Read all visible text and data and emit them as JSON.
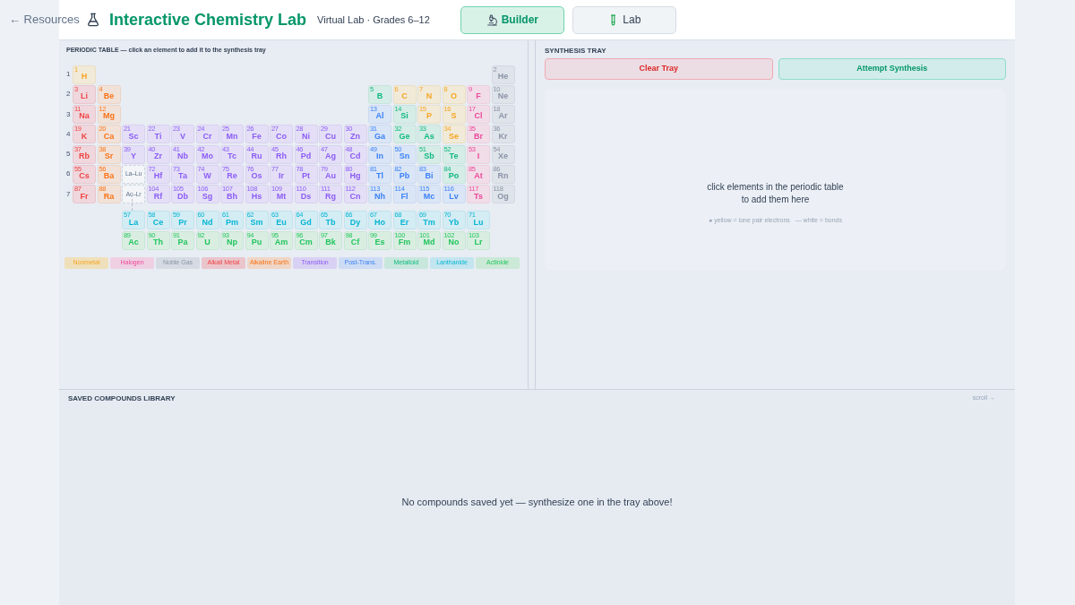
{
  "header": {
    "back_link": "← Resources",
    "title": "Interactive Chemistry Lab",
    "subtitle": "Virtual Lab · Grades 6–12",
    "tabs": [
      {
        "label": "Builder",
        "kind": "microscope",
        "selected": true
      },
      {
        "label": "Lab",
        "kind": "tube",
        "selected": false
      }
    ]
  },
  "periodic_table": {
    "heading": "PERIODIC TABLE — click an element to add it to the synthesis tray",
    "rows": [
      {
        "label": "1",
        "left": [
          {
            "number": "1",
            "symbol": "H",
            "kind": "nonmetal"
          }
        ],
        "right": [
          {
            "number": "2",
            "symbol": "He",
            "kind": "noble"
          }
        ]
      },
      {
        "label": "2",
        "left": [
          {
            "number": "3",
            "symbol": "Li",
            "kind": "alkali"
          },
          {
            "number": "4",
            "symbol": "Be",
            "kind": "alkaline"
          }
        ],
        "right": [
          {
            "number": "5",
            "symbol": "B",
            "kind": "metalloid"
          },
          {
            "number": "6",
            "symbol": "C",
            "kind": "nonmetal"
          },
          {
            "number": "7",
            "symbol": "N",
            "kind": "nonmetal"
          },
          {
            "number": "8",
            "symbol": "O",
            "kind": "nonmetal"
          },
          {
            "number": "9",
            "symbol": "F",
            "kind": "halogen"
          },
          {
            "number": "10",
            "symbol": "Ne",
            "kind": "noble"
          }
        ]
      },
      {
        "label": "3",
        "left": [
          {
            "number": "11",
            "symbol": "Na",
            "kind": "alkali"
          },
          {
            "number": "12",
            "symbol": "Mg",
            "kind": "alkaline"
          }
        ],
        "right": [
          {
            "number": "13",
            "symbol": "Al",
            "kind": "post"
          },
          {
            "number": "14",
            "symbol": "Si",
            "kind": "metalloid"
          },
          {
            "number": "15",
            "symbol": "P",
            "kind": "nonmetal"
          },
          {
            "number": "16",
            "symbol": "S",
            "kind": "nonmetal"
          },
          {
            "number": "17",
            "symbol": "Cl",
            "kind": "halogen"
          },
          {
            "number": "18",
            "symbol": "Ar",
            "kind": "noble"
          }
        ]
      },
      {
        "label": "4",
        "left": [
          {
            "number": "19",
            "symbol": "K",
            "kind": "alkali"
          },
          {
            "number": "20",
            "symbol": "Ca",
            "kind": "alkaline"
          },
          {
            "number": "21",
            "symbol": "Sc",
            "kind": "transition"
          },
          {
            "number": "22",
            "symbol": "Ti",
            "kind": "transition"
          },
          {
            "number": "23",
            "symbol": "V",
            "kind": "transition"
          },
          {
            "number": "24",
            "symbol": "Cr",
            "kind": "transition"
          },
          {
            "number": "25",
            "symbol": "Mn",
            "kind": "transition"
          },
          {
            "number": "26",
            "symbol": "Fe",
            "kind": "transition"
          },
          {
            "number": "27",
            "symbol": "Co",
            "kind": "transition"
          },
          {
            "number": "28",
            "symbol": "Ni",
            "kind": "transition"
          },
          {
            "number": "29",
            "symbol": "Cu",
            "kind": "transition"
          },
          {
            "number": "30",
            "symbol": "Zn",
            "kind": "transition"
          },
          {
            "number": "31",
            "symbol": "Ga",
            "kind": "post"
          },
          {
            "number": "32",
            "symbol": "Ge",
            "kind": "metalloid"
          },
          {
            "number": "33",
            "symbol": "As",
            "kind": "metalloid"
          },
          {
            "number": "34",
            "symbol": "Se",
            "kind": "nonmetal"
          },
          {
            "number": "35",
            "symbol": "Br",
            "kind": "halogen"
          },
          {
            "number": "36",
            "symbol": "Kr",
            "kind": "noble"
          }
        ]
      },
      {
        "label": "5",
        "left": [
          {
            "number": "37",
            "symbol": "Rb",
            "kind": "alkali"
          },
          {
            "number": "38",
            "symbol": "Sr",
            "kind": "alkaline"
          },
          {
            "number": "39",
            "symbol": "Y",
            "kind": "transition"
          },
          {
            "number": "40",
            "symbol": "Zr",
            "kind": "transition"
          },
          {
            "number": "41",
            "symbol": "Nb",
            "kind": "transition"
          },
          {
            "number": "42",
            "symbol": "Mo",
            "kind": "transition"
          },
          {
            "number": "43",
            "symbol": "Tc",
            "kind": "transition"
          },
          {
            "number": "44",
            "symbol": "Ru",
            "kind": "transition"
          },
          {
            "number": "45",
            "symbol": "Rh",
            "kind": "transition"
          },
          {
            "number": "46",
            "symbol": "Pd",
            "kind": "transition"
          },
          {
            "number": "47",
            "symbol": "Ag",
            "kind": "transition"
          },
          {
            "number": "48",
            "symbol": "Cd",
            "kind": "transition"
          },
          {
            "number": "49",
            "symbol": "In",
            "kind": "post"
          },
          {
            "number": "50",
            "symbol": "Sn",
            "kind": "post"
          },
          {
            "number": "51",
            "symbol": "Sb",
            "kind": "metalloid"
          },
          {
            "number": "52",
            "symbol": "Te",
            "kind": "metalloid"
          },
          {
            "number": "53",
            "symbol": "I",
            "kind": "halogen"
          },
          {
            "number": "54",
            "symbol": "Xe",
            "kind": "noble"
          }
        ]
      },
      {
        "label": "6",
        "left": [
          {
            "number": "55",
            "symbol": "Cs",
            "kind": "alkali"
          },
          {
            "number": "56",
            "symbol": "Ba",
            "kind": "alkaline"
          },
          {
            "kind": "placeholder",
            "symbol": "La–Lu"
          },
          {
            "number": "72",
            "symbol": "Hf",
            "kind": "transition"
          },
          {
            "number": "73",
            "symbol": "Ta",
            "kind": "transition"
          },
          {
            "number": "74",
            "symbol": "W",
            "kind": "transition"
          },
          {
            "number": "75",
            "symbol": "Re",
            "kind": "transition"
          },
          {
            "number": "76",
            "symbol": "Os",
            "kind": "transition"
          },
          {
            "number": "77",
            "symbol": "Ir",
            "kind": "transition"
          },
          {
            "number": "78",
            "symbol": "Pt",
            "kind": "transition"
          },
          {
            "number": "79",
            "symbol": "Au",
            "kind": "transition"
          },
          {
            "number": "80",
            "symbol": "Hg",
            "kind": "transition"
          },
          {
            "number": "81",
            "symbol": "Tl",
            "kind": "post"
          },
          {
            "number": "82",
            "symbol": "Pb",
            "kind": "post"
          },
          {
            "number": "83",
            "symbol": "Bi",
            "kind": "post"
          },
          {
            "number": "84",
            "symbol": "Po",
            "kind": "metalloid"
          },
          {
            "number": "85",
            "symbol": "At",
            "kind": "halogen"
          },
          {
            "number": "86",
            "symbol": "Rn",
            "kind": "noble"
          }
        ]
      },
      {
        "label": "7",
        "left": [
          {
            "number": "87",
            "symbol": "Fr",
            "kind": "alkali"
          },
          {
            "number": "88",
            "symbol": "Ra",
            "kind": "alkaline"
          },
          {
            "kind": "placeholder",
            "symbol": "Ac–Lr"
          },
          {
            "number": "104",
            "symbol": "Rf",
            "kind": "transition"
          },
          {
            "number": "105",
            "symbol": "Db",
            "kind": "transition"
          },
          {
            "number": "106",
            "symbol": "Sg",
            "kind": "transition"
          },
          {
            "number": "107",
            "symbol": "Bh",
            "kind": "transition"
          },
          {
            "number": "108",
            "symbol": "Hs",
            "kind": "transition"
          },
          {
            "number": "109",
            "symbol": "Mt",
            "kind": "transition"
          },
          {
            "number": "110",
            "symbol": "Ds",
            "kind": "transition"
          },
          {
            "number": "111",
            "symbol": "Rg",
            "kind": "transition"
          },
          {
            "number": "112",
            "symbol": "Cn",
            "kind": "transition"
          },
          {
            "number": "113",
            "symbol": "Nh",
            "kind": "post"
          },
          {
            "number": "114",
            "symbol": "Fl",
            "kind": "post"
          },
          {
            "number": "115",
            "symbol": "Mc",
            "kind": "post"
          },
          {
            "number": "116",
            "symbol": "Lv",
            "kind": "post"
          },
          {
            "number": "117",
            "symbol": "Ts",
            "kind": "halogen"
          },
          {
            "number": "118",
            "symbol": "Og",
            "kind": "noble"
          }
        ]
      }
    ],
    "f_block": [
      [
        {
          "number": "57",
          "symbol": "La",
          "kind": "lanthanide"
        },
        {
          "number": "58",
          "symbol": "Ce",
          "kind": "lanthanide"
        },
        {
          "number": "59",
          "symbol": "Pr",
          "kind": "lanthanide"
        },
        {
          "number": "60",
          "symbol": "Nd",
          "kind": "lanthanide"
        },
        {
          "number": "61",
          "symbol": "Pm",
          "kind": "lanthanide"
        },
        {
          "number": "62",
          "symbol": "Sm",
          "kind": "lanthanide"
        },
        {
          "number": "63",
          "symbol": "Eu",
          "kind": "lanthanide"
        },
        {
          "number": "64",
          "symbol": "Gd",
          "kind": "lanthanide"
        },
        {
          "number": "65",
          "symbol": "Tb",
          "kind": "lanthanide"
        },
        {
          "number": "66",
          "symbol": "Dy",
          "kind": "lanthanide"
        },
        {
          "number": "67",
          "symbol": "Ho",
          "kind": "lanthanide"
        },
        {
          "number": "68",
          "symbol": "Er",
          "kind": "lanthanide"
        },
        {
          "number": "69",
          "symbol": "Tm",
          "kind": "lanthanide"
        },
        {
          "number": "70",
          "symbol": "Yb",
          "kind": "lanthanide"
        },
        {
          "number": "71",
          "symbol": "Lu",
          "kind": "lanthanide"
        }
      ],
      [
        {
          "number": "89",
          "symbol": "Ac",
          "kind": "actinide"
        },
        {
          "number": "90",
          "symbol": "Th",
          "kind": "actinide"
        },
        {
          "number": "91",
          "symbol": "Pa",
          "kind": "actinide"
        },
        {
          "number": "92",
          "symbol": "U",
          "kind": "actinide"
        },
        {
          "number": "93",
          "symbol": "Np",
          "kind": "actinide"
        },
        {
          "number": "94",
          "symbol": "Pu",
          "kind": "actinide"
        },
        {
          "number": "95",
          "symbol": "Am",
          "kind": "actinide"
        },
        {
          "number": "96",
          "symbol": "Cm",
          "kind": "actinide"
        },
        {
          "number": "97",
          "symbol": "Bk",
          "kind": "actinide"
        },
        {
          "number": "98",
          "symbol": "Cf",
          "kind": "actinide"
        },
        {
          "number": "99",
          "symbol": "Es",
          "kind": "actinide"
        },
        {
          "number": "100",
          "symbol": "Fm",
          "kind": "actinide"
        },
        {
          "number": "101",
          "symbol": "Md",
          "kind": "actinide"
        },
        {
          "number": "102",
          "symbol": "No",
          "kind": "actinide"
        },
        {
          "number": "103",
          "symbol": "Lr",
          "kind": "actinide"
        }
      ]
    ],
    "legend": [
      {
        "label": "Nonmetal",
        "kind": "nonmetal"
      },
      {
        "label": "Halogen",
        "kind": "halogen"
      },
      {
        "label": "Noble Gas",
        "kind": "noble"
      },
      {
        "label": "Alkali Metal",
        "kind": "alkali"
      },
      {
        "label": "Alkaline Earth",
        "kind": "alkaline"
      },
      {
        "label": "Transition",
        "kind": "transition"
      },
      {
        "label": "Post-Trans.",
        "kind": "post"
      },
      {
        "label": "Metalloid",
        "kind": "metalloid"
      },
      {
        "label": "Lanthanide",
        "kind": "lanthanide"
      },
      {
        "label": "Actinide",
        "kind": "actinide"
      }
    ]
  },
  "synthesis_tray": {
    "heading": "SYNTHESIS TRAY",
    "buttons": [
      {
        "label": "Clear Tray",
        "kind": "danger"
      },
      {
        "label": "Attempt Synthesis",
        "kind": "primary"
      }
    ],
    "empty_message": "click elements in the periodic table\nto add them here",
    "key_note": "● yellow = lone pair electrons   — white = bonds"
  },
  "library": {
    "heading": "SAVED COMPOUNDS LIBRARY",
    "scroll_hint": "scroll →",
    "empty_message": "No compounds saved yet — synthesize one in the tray above!"
  }
}
